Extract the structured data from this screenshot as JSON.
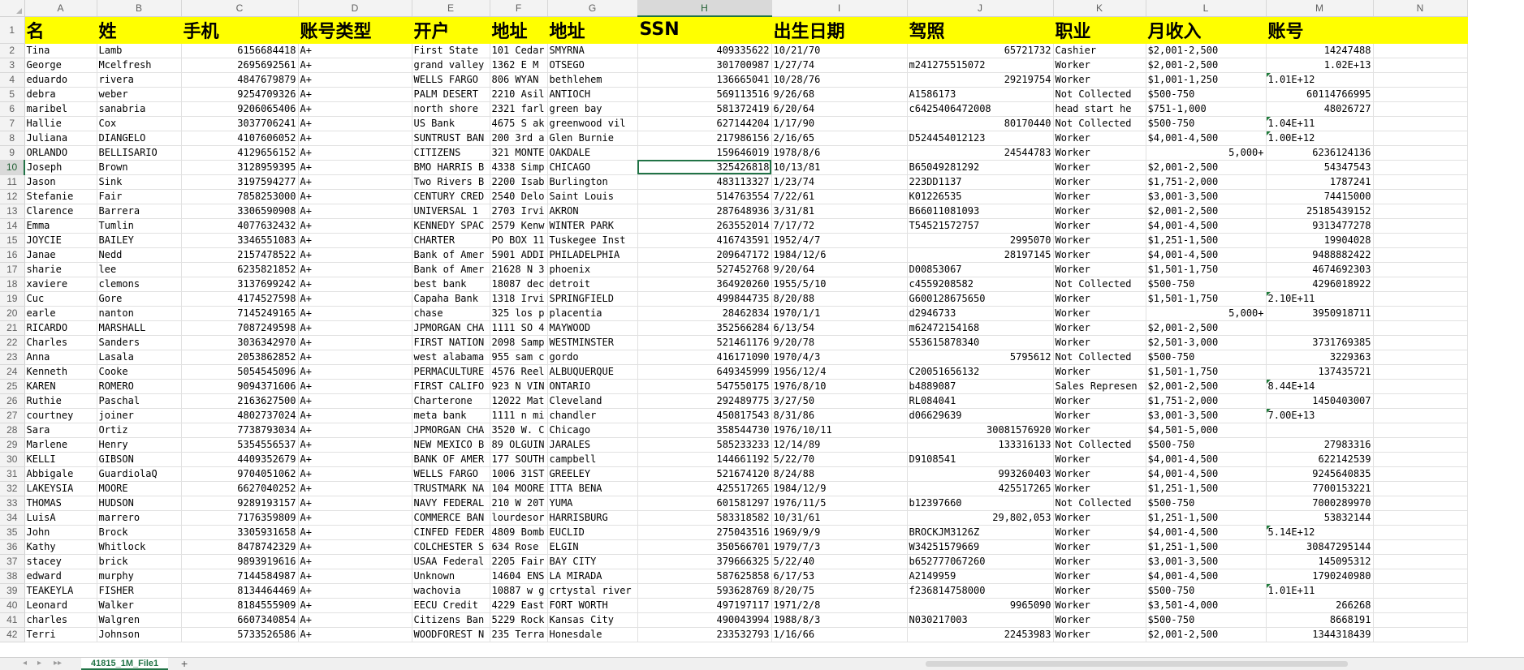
{
  "columns": [
    "A",
    "B",
    "C",
    "D",
    "E",
    "F",
    "G",
    "H",
    "I",
    "J",
    "K",
    "L",
    "M",
    "N"
  ],
  "selected_column": "H",
  "selected_row": 10,
  "header_row": [
    "名",
    "姓",
    "手机",
    "账号类型",
    "开户",
    "地址",
    "地址",
    "SSN",
    "出生日期",
    "驾照",
    "职业",
    "月收入",
    "账号",
    ""
  ],
  "rows": [
    {
      "n": "2",
      "c": [
        "Tina",
        "Lamb",
        "6156684418",
        "A+",
        "First State",
        "101 Cedar",
        "SMYRNA",
        "409335622",
        "10/21/70",
        "65721732",
        "Cashier",
        "$2,001-2,500",
        "14247488",
        ""
      ]
    },
    {
      "n": "3",
      "c": [
        "George",
        "Mcelfresh",
        "2695692561",
        "A+",
        "grand valley",
        "1362 E M",
        "OTSEGO",
        "301700987",
        "1/27/74",
        "m241275515072",
        "Worker",
        "$2,001-2,500",
        "1.02E+13",
        ""
      ]
    },
    {
      "n": "4",
      "c": [
        "eduardo",
        "rivera",
        "4847679879",
        "A+",
        "WELLS FARGO",
        "806 WYAN",
        "bethlehem",
        "136665041",
        "10/28/76",
        "29219754",
        "Worker",
        "$1,001-1,250",
        "1.01E+12",
        ""
      ]
    },
    {
      "n": "5",
      "c": [
        "debra",
        "weber",
        "9254709326",
        "A+",
        "PALM DESERT",
        "2210 Asil",
        "ANTIOCH",
        "569113516",
        "9/26/68",
        "A1586173",
        "Not Collected",
        "$500-750",
        "60114766995",
        ""
      ]
    },
    {
      "n": "6",
      "c": [
        "maribel",
        "sanabria",
        "9206065406",
        "A+",
        "north shore",
        "2321 farl",
        "green bay",
        "581372419",
        "6/20/64",
        "c6425406472008",
        "head start he",
        "$751-1,000",
        "48026727",
        ""
      ]
    },
    {
      "n": "7",
      "c": [
        "Hallie",
        "Cox",
        "3037706241",
        "A+",
        "US Bank",
        "4675 S ak",
        "greenwood vil",
        "627144204",
        "1/17/90",
        "80170440",
        "Not Collected",
        "$500-750",
        "1.04E+11",
        ""
      ]
    },
    {
      "n": "8",
      "c": [
        "Juliana",
        "DIANGELO",
        "4107606052",
        "A+",
        "SUNTRUST BAN",
        "200 3rd a",
        "Glen Burnie",
        "217986156",
        "2/16/65",
        "D524454012123",
        "Worker",
        "$4,001-4,500",
        "1.00E+12",
        ""
      ]
    },
    {
      "n": "9",
      "c": [
        "ORLANDO",
        "BELLISARIO",
        "4129656152",
        "A+",
        "CITIZENS",
        "321 MONTE",
        "OAKDALE",
        "159646019",
        "1978/8/6",
        "24544783",
        "Worker",
        "5,000+",
        "6236124136",
        ""
      ]
    },
    {
      "n": "10",
      "c": [
        "Joseph",
        "Brown",
        "3128959395",
        "A+",
        "BMO HARRIS B",
        "4338 Simp",
        "CHICAGO",
        "325426818",
        "10/13/81",
        "B65049281292",
        "Worker",
        "$2,001-2,500",
        "54347543",
        ""
      ]
    },
    {
      "n": "11",
      "c": [
        "Jason",
        "Sink",
        "3197594277",
        "A+",
        "Two Rivers B",
        "2200 Isab",
        "Burlington",
        "483113327",
        "1/23/74",
        "223DD1137",
        "Worker",
        "$1,751-2,000",
        "1787241",
        ""
      ]
    },
    {
      "n": "12",
      "c": [
        "Stefanie",
        "Fair",
        "7858253000",
        "A+",
        "CENTURY CRED",
        "2540 Delo",
        "Saint Louis",
        "514763554",
        "7/22/61",
        "K01226535",
        "Worker",
        "$3,001-3,500",
        "74415000",
        ""
      ]
    },
    {
      "n": "13",
      "c": [
        "Clarence",
        "Barrera",
        "3306590908",
        "A+",
        "UNIVERSAL 1",
        "2703 Irvi",
        "AKRON",
        "287648936",
        "3/31/81",
        "B66011081093",
        "Worker",
        "$2,001-2,500",
        "25185439152",
        ""
      ]
    },
    {
      "n": "14",
      "c": [
        "Emma",
        "Tumlin",
        "4077632432",
        "A+",
        "KENNEDY SPAC",
        "2579 Kenw",
        "WINTER PARK",
        "263552014",
        "7/17/72",
        "T54521572757",
        "Worker",
        "$4,001-4,500",
        "9313477278",
        ""
      ]
    },
    {
      "n": "15",
      "c": [
        "JOYCIE",
        "BAILEY",
        "3346551083",
        "A+",
        "CHARTER",
        "PO BOX 11",
        "Tuskegee Inst",
        "416743591",
        "1952/4/7",
        "2995070",
        "Worker",
        "$1,251-1,500",
        "19904028",
        ""
      ]
    },
    {
      "n": "16",
      "c": [
        "Janae",
        "Nedd",
        "2157478522",
        "A+",
        "Bank of Amer",
        "5901 ADDI",
        "PHILADELPHIA",
        "209647172",
        "1984/12/6",
        "28197145",
        "Worker",
        "$4,001-4,500",
        "9488882422",
        ""
      ]
    },
    {
      "n": "17",
      "c": [
        "sharie",
        "lee",
        "6235821852",
        "A+",
        "Bank of Amer",
        "21628 N 3",
        "phoenix",
        "527452768",
        "9/20/64",
        "D00853067",
        "Worker",
        "$1,501-1,750",
        "4674692303",
        ""
      ]
    },
    {
      "n": "18",
      "c": [
        "xaviere",
        "clemons",
        "3137699242",
        "A+",
        "best bank",
        "18087 dec",
        "detroit",
        "364920260",
        "1955/5/10",
        "c4559208582",
        "Not Collected",
        "$500-750",
        "4296018922",
        ""
      ]
    },
    {
      "n": "19",
      "c": [
        "Cuc",
        "Gore",
        "4174527598",
        "A+",
        "Capaha Bank",
        "1318 Irvi",
        "SPRINGFIELD",
        "499844735",
        "8/20/88",
        "G600128675650",
        "Worker",
        "$1,501-1,750",
        "2.10E+11",
        ""
      ]
    },
    {
      "n": "20",
      "c": [
        "earle",
        "nanton",
        "7145249165",
        "A+",
        "chase",
        "325 los p",
        "placentia",
        "28462834",
        "1970/1/1",
        "d2946733",
        "Worker",
        "5,000+",
        "3950918711",
        ""
      ]
    },
    {
      "n": "21",
      "c": [
        "RICARDO",
        "MARSHALL",
        "7087249598",
        "A+",
        "JPMORGAN CHA",
        "1111 SO 4",
        "MAYWOOD",
        "352566284",
        "6/13/54",
        "m62472154168",
        "Worker",
        "$2,001-2,500",
        "",
        ""
      ]
    },
    {
      "n": "22",
      "c": [
        "Charles",
        "Sanders",
        "3036342970",
        "A+",
        "FIRST NATION",
        "2098 Samp",
        "WESTMINSTER",
        "521461176",
        "9/20/78",
        "S53615878340",
        "Worker",
        "$2,501-3,000",
        "3731769385",
        ""
      ]
    },
    {
      "n": "23",
      "c": [
        "Anna",
        "Lasala",
        "2053862852",
        "A+",
        "west alabama",
        "955 sam c",
        "gordo",
        "416171090",
        "1970/4/3",
        "5795612",
        "Not Collected",
        "$500-750",
        "3229363",
        ""
      ]
    },
    {
      "n": "24",
      "c": [
        "Kenneth",
        "Cooke",
        "5054545096",
        "A+",
        "PERMACULTURE",
        "4576 Reel",
        "ALBUQUERQUE",
        "649345999",
        "1956/12/4",
        "C20051656132",
        "Worker",
        "$1,501-1,750",
        "137435721",
        ""
      ]
    },
    {
      "n": "25",
      "c": [
        "KAREN",
        "ROMERO",
        "9094371606",
        "A+",
        "FIRST CALIFO",
        "923 N VIN",
        "ONTARIO",
        "547550175",
        "1976/8/10",
        "b4889087",
        "Sales Represen",
        "$2,001-2,500",
        "8.44E+14",
        ""
      ]
    },
    {
      "n": "26",
      "c": [
        "Ruthie",
        "Paschal",
        "2163627500",
        "A+",
        "Charterone",
        "12022 Mat",
        "Cleveland",
        "292489775",
        "3/27/50",
        "RL084041",
        "Worker",
        "$1,751-2,000",
        "1450403007",
        ""
      ]
    },
    {
      "n": "27",
      "c": [
        "courtney",
        "joiner",
        "4802737024",
        "A+",
        "meta bank",
        "1111 n mi",
        "chandler",
        "450817543",
        "8/31/86",
        "d06629639",
        "Worker",
        "$3,001-3,500",
        "7.00E+13",
        ""
      ]
    },
    {
      "n": "28",
      "c": [
        "Sara",
        "Ortiz",
        "7738793034",
        "A+",
        "JPMORGAN CHA",
        "3520 W. C",
        "Chicago",
        "358544730",
        "1976/10/11",
        "30081576920",
        "Worker",
        "$4,501-5,000",
        "",
        ""
      ]
    },
    {
      "n": "29",
      "c": [
        "Marlene",
        "Henry",
        "5354556537",
        "A+",
        "NEW MEXICO B",
        "89 OLGUIN",
        "JARALES",
        "585233233",
        "12/14/89",
        "133316133",
        "Not Collected",
        "$500-750",
        "27983316",
        ""
      ]
    },
    {
      "n": "30",
      "c": [
        "KELLI",
        "GIBSON",
        "4409352679",
        "A+",
        "BANK OF AMER",
        "177 SOUTH",
        "campbell",
        "144661192",
        "5/22/70",
        "D9108541",
        "Worker",
        "$4,001-4,500",
        "622142539",
        ""
      ]
    },
    {
      "n": "31",
      "c": [
        "Abbigale",
        "GuardiolaQ",
        "9704051062",
        "A+",
        "WELLS FARGO",
        "1006 31ST",
        "GREELEY",
        "521674120",
        "8/24/88",
        "993260403",
        "Worker",
        "$4,001-4,500",
        "9245640835",
        ""
      ]
    },
    {
      "n": "32",
      "c": [
        "LAKEYSIA",
        "MOORE",
        "6627040252",
        "A+",
        "TRUSTMARK NA",
        "104 MOORE",
        "ITTA BENA",
        "425517265",
        "1984/12/9",
        "425517265",
        "Worker",
        "$1,251-1,500",
        "7700153221",
        ""
      ]
    },
    {
      "n": "33",
      "c": [
        "THOMAS",
        "HUDSON",
        "9289193157",
        "A+",
        "NAVY FEDERAL",
        "210 W 20T",
        "YUMA",
        "601581297",
        "1976/11/5",
        "b12397660",
        "Not Collected",
        "$500-750",
        "7000289970",
        ""
      ]
    },
    {
      "n": "34",
      "c": [
        "LuisA",
        "marrero",
        "7176359809",
        "A+",
        "COMMERCE BAN",
        "lourdesor",
        "HARRISBURG",
        "583318582",
        "10/31/61",
        "29,802,053",
        "Worker",
        "$1,251-1,500",
        "53832144",
        ""
      ]
    },
    {
      "n": "35",
      "c": [
        "John",
        "Brock",
        "3305931658",
        "A+",
        "CINFED FEDER",
        "4809 Bomb",
        "EUCLID",
        "275043516",
        "1969/9/9",
        "BROCKJM3126Z",
        "Worker",
        "$4,001-4,500",
        "5.14E+12",
        ""
      ]
    },
    {
      "n": "36",
      "c": [
        "Kathy",
        "Whitlock",
        "8478742329",
        "A+",
        "COLCHESTER S",
        "634 Rose",
        "ELGIN",
        "350566701",
        "1979/7/3",
        "W34251579669",
        "Worker",
        "$1,251-1,500",
        "30847295144",
        ""
      ]
    },
    {
      "n": "37",
      "c": [
        "stacey",
        "brick",
        "9893919616",
        "A+",
        "USAA Federal",
        "2205 Fair",
        "BAY CITY",
        "379666325",
        "5/22/40",
        "b652777067260",
        "Worker",
        "$3,001-3,500",
        "145095312",
        ""
      ]
    },
    {
      "n": "38",
      "c": [
        "edward",
        "murphy",
        "7144584987",
        "A+",
        "Unknown",
        "14604 ENS",
        "LA MIRADA",
        "587625858",
        "6/17/53",
        "A2149959",
        "Worker",
        "$4,001-4,500",
        "1790240980",
        ""
      ]
    },
    {
      "n": "39",
      "c": [
        "TEAKEYLA",
        "FISHER",
        "8134464469",
        "A+",
        "wachovia",
        "10887 w g",
        "crtystal river",
        "593628769",
        "8/20/75",
        "f236814758000",
        "Worker",
        "$500-750",
        "1.01E+11",
        ""
      ]
    },
    {
      "n": "40",
      "c": [
        "Leonard",
        "Walker",
        "8184555909",
        "A+",
        "EECU Credit",
        "4229 East",
        "FORT WORTH",
        "497197117",
        "1971/2/8",
        "9965090",
        "Worker",
        "$3,501-4,000",
        "266268",
        ""
      ]
    },
    {
      "n": "41",
      "c": [
        "charles",
        "Walgren",
        "6607340854",
        "A+",
        "Citizens Ban",
        "5229 Rock",
        "Kansas City",
        "490043994",
        "1988/8/3",
        "N030217003",
        "Worker",
        "$500-750",
        "8668191",
        ""
      ]
    },
    {
      "n": "42",
      "c": [
        "Terri",
        "Johnson",
        "5733526586",
        "A+",
        "WOODFOREST N",
        "235 Terra",
        "Honesdale",
        "233532793",
        "1/16/66",
        "22453983",
        "Worker",
        "$2,001-2,500",
        "1344318439",
        ""
      ]
    }
  ],
  "sheet_tab": "41815_1M_File1",
  "add_sheet_label": "+",
  "nav_arrows": "‹ › ⏮",
  "colors": {
    "header_fill": "#ffff00",
    "selection": "#217346",
    "flag": "#1e7b3a"
  }
}
